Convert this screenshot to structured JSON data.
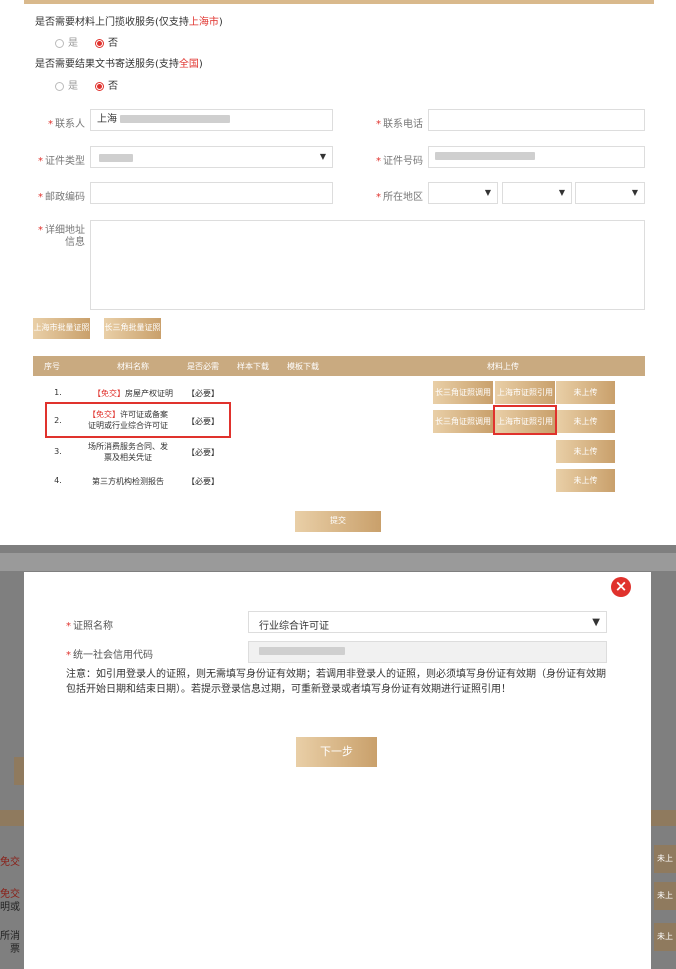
{
  "form": {
    "q_pickup": {
      "text_a": "是否需要材料上门揽收服务(仅支持",
      "text_red": "上海市",
      "text_b": ")"
    },
    "q_mail": {
      "text_a": "是否需要结果文书寄送服务(支持",
      "text_red": "全国",
      "text_b": ")"
    },
    "yes": "是",
    "no": "否",
    "contact_label": "联系人",
    "contact_value": "上海",
    "phone_label": "联系电话",
    "idtype_label": "证件类型",
    "idno_label": "证件号码",
    "postcode_label": "邮政编码",
    "region_label": "所在地区",
    "address_label": "详细地址信息",
    "btn_shanghai": "上海市批量证照",
    "btn_yrd": "长三角批量证照",
    "submit": "提交"
  },
  "table": {
    "headers": [
      "序号",
      "材料名称",
      "是否必需",
      "样本下载",
      "模板下载",
      "材料上传"
    ],
    "rows": [
      {
        "no": "1.",
        "tag": "【免交】",
        "name": "房屋产权证明",
        "required": "【必要】",
        "buttons": [
          "长三角证照调用",
          "上海市证照引用",
          "未上传"
        ]
      },
      {
        "no": "2.",
        "tag": "【免交】",
        "name": "许可证或备案证明或行业综合许可证",
        "required": "【必要】",
        "buttons": [
          "长三角证照调用",
          "上海市证照引用",
          "未上传"
        ]
      },
      {
        "no": "3.",
        "tag": "",
        "name": "场所消费服务合同、发票及相关凭证",
        "required": "【必要】",
        "buttons": [
          "未上传"
        ]
      },
      {
        "no": "4.",
        "tag": "",
        "name": "第三方机构检测报告",
        "required": "【必要】",
        "buttons": [
          "未上传"
        ]
      }
    ]
  },
  "modal": {
    "close": "×",
    "license_label": "证照名称",
    "license_value": "行业综合许可证",
    "credit_label": "统一社会信用代码",
    "note": "注意：如引用登录人的证照，则无需填写身份证有效期；若调用非登录人的证照，则必须填写身份证有效期（身份证有效期包括开始日期和结束日期）。若提示登录信息过期，可重新登录或者填写身份证有效期进行证照引用！",
    "next": "下一步"
  },
  "background_peek": {
    "left": [
      "免交",
      "免交",
      "明或",
      "所消",
      "票"
    ],
    "right": [
      "未上",
      "未上",
      "未上"
    ]
  },
  "colors": {
    "accent_red": "#e0322d",
    "gold": "#c9a06b",
    "gold_light": "#e9cfa7",
    "overlay": "#7f7f7f"
  }
}
